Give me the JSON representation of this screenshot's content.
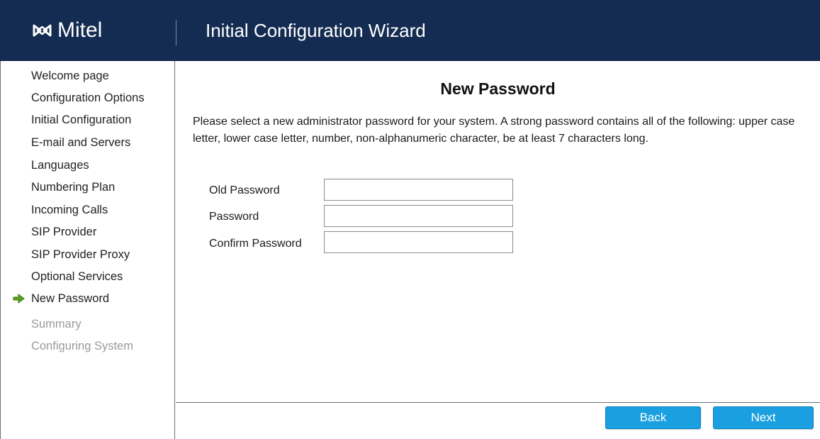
{
  "header": {
    "logo_text": "Mitel",
    "title": "Initial Configuration Wizard"
  },
  "sidebar": {
    "items": [
      {
        "label": "Welcome page",
        "state": "completed"
      },
      {
        "label": "Configuration Options",
        "state": "completed"
      },
      {
        "label": "Initial Configuration",
        "state": "completed"
      },
      {
        "label": "E-mail and Servers",
        "state": "completed"
      },
      {
        "label": "Languages",
        "state": "completed"
      },
      {
        "label": "Numbering Plan",
        "state": "completed"
      },
      {
        "label": "Incoming Calls",
        "state": "completed"
      },
      {
        "label": "SIP Provider",
        "state": "completed"
      },
      {
        "label": "SIP Provider Proxy",
        "state": "completed"
      },
      {
        "label": "Optional Services",
        "state": "completed"
      },
      {
        "label": "New Password",
        "state": "current"
      },
      {
        "label": "Summary",
        "state": "disabled"
      },
      {
        "label": "Configuring System",
        "state": "disabled"
      }
    ],
    "current_indicator_icon": "green-arrow-right-icon"
  },
  "main": {
    "title": "New Password",
    "description": "Please select a new administrator password for your system. A strong password contains all of the following: upper case letter, lower case letter, number, non-alphanumeric character, be at least 7 characters long.",
    "fields": {
      "old_password": {
        "label": "Old Password",
        "value": ""
      },
      "password": {
        "label": "Password",
        "value": ""
      },
      "confirm_password": {
        "label": "Confirm Password",
        "value": ""
      }
    }
  },
  "footer": {
    "back_label": "Back",
    "next_label": "Next"
  },
  "colors": {
    "header_bg": "#152c52",
    "button_bg": "#1aa0e0",
    "arrow_green": "#5aa020",
    "disabled_text": "#9a9a9a"
  }
}
